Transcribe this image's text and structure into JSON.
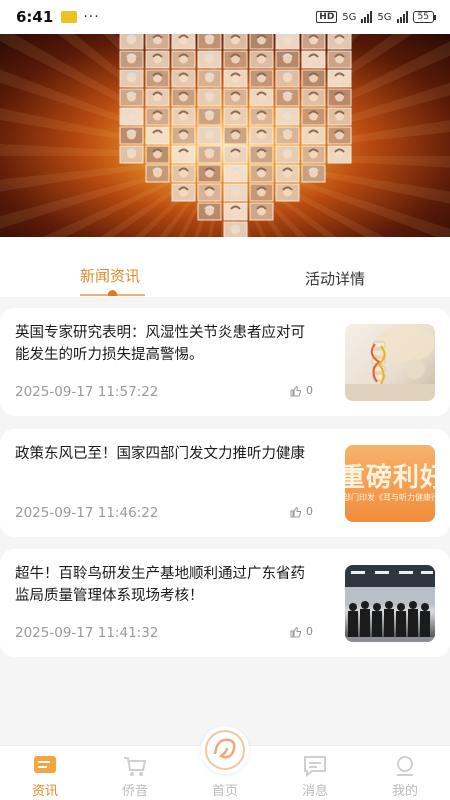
{
  "status_bar": {
    "time": "6:41",
    "dots": "···",
    "hd": "HD",
    "net1": "5G",
    "net2": "5G",
    "battery": "55"
  },
  "banner": {
    "theme": "collage of elderly faces forming a heart on orange radial burst"
  },
  "tabs": {
    "news": "新闻资讯",
    "activity": "活动详情",
    "active": "news"
  },
  "news": [
    {
      "title": "英国专家研究表明：风湿性关节炎患者应对可能发生的听力损失提高警惕。",
      "time": "2025-09-17 11:57:22",
      "likes": "0",
      "thumb_icon": "spine-model-image"
    },
    {
      "title": "政策东风已至！国家四部门发文力推听力健康",
      "time": "2025-09-17 11:46:22",
      "likes": "0",
      "thumb_icon": "policy-promo-image",
      "thumb_text": "重磅利好",
      "thumb_sub": "部门印发《耳与听力健康行"
    },
    {
      "title": "超牛！百聆鸟研发生产基地顺利通过广东省药监局质量管理体系现场考核！",
      "time": "2025-09-17 11:41:32",
      "likes": "0",
      "thumb_icon": "team-photo-image"
    }
  ],
  "nav": [
    {
      "label": "资讯",
      "icon": "news-icon",
      "active": true
    },
    {
      "label": "侨音",
      "icon": "cart-icon",
      "active": false
    },
    {
      "label": "首页",
      "icon": "home-logo-icon",
      "active": false
    },
    {
      "label": "消息",
      "icon": "message-icon",
      "active": false
    },
    {
      "label": "我的",
      "icon": "profile-icon",
      "active": false
    }
  ],
  "colors": {
    "accent": "#e08a2a",
    "inactive": "#bbbbbb",
    "time_text": "#9a9a9a"
  }
}
